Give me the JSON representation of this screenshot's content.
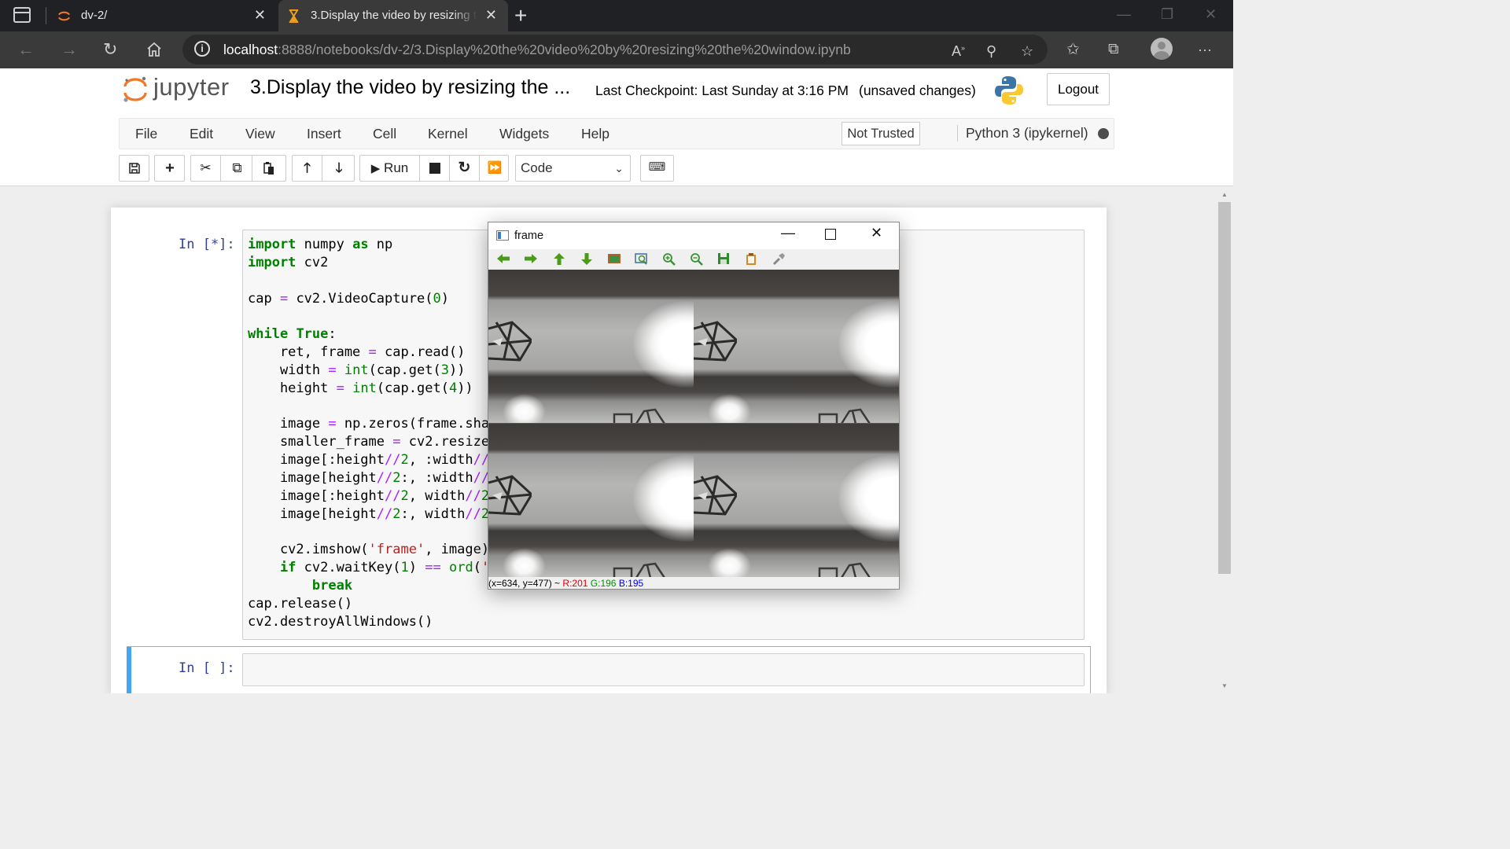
{
  "browser": {
    "tabs": [
      {
        "label": "dv-2/"
      },
      {
        "label": "3.Display the video by resizing th"
      }
    ],
    "url_host": "localhost",
    "url_rest": ":8888/notebooks/dv-2/3.Display%20the%20video%20by%20resizing%20the%20window.ipynb"
  },
  "jupyter": {
    "logo_text": "jupyter",
    "notebook_title": "3.Display the video by resizing the ...",
    "checkpoint": "Last Checkpoint: Last Sunday at 3:16 PM",
    "unsaved": "(unsaved changes)",
    "logout_label": "Logout"
  },
  "menu": {
    "items": [
      "File",
      "Edit",
      "View",
      "Insert",
      "Cell",
      "Kernel",
      "Widgets",
      "Help"
    ],
    "trust_label": "Not Trusted",
    "kernel_name": "Python 3 (ipykernel)"
  },
  "toolbar": {
    "run_label": "Run",
    "cell_type": "Code"
  },
  "cells": [
    {
      "prompt": "In [*]:"
    },
    {
      "prompt": "In [ ]:"
    }
  ],
  "code_lines": [
    "import numpy as np",
    "import cv2",
    "",
    "cap = cv2.VideoCapture(0)",
    "",
    "while True:",
    "    ret, frame = cap.read()",
    "    width = int(cap.get(3))",
    "    height = int(cap.get(4))",
    "",
    "    image = np.zeros(frame.sha",
    "    smaller_frame = cv2.resize",
    "    image[:height//2, :width//",
    "    image[height//2:, :width//",
    "    image[:height//2, width//2",
    "    image[height//2:, width//2",
    "",
    "    cv2.imshow('frame', image)",
    "    if cv2.waitKey(1) == ord('",
    "        break",
    "cap.release()",
    "cv2.destroyAllWindows()"
  ],
  "cv_window": {
    "title": "frame",
    "status_coords": "(x=634, y=477) ~",
    "status_r": "R:201",
    "status_g": "G:196",
    "status_b": "B:195"
  },
  "colors": {
    "keyword": "#008000",
    "operator": "#aa22ff",
    "string": "#ba2121",
    "prompt": "#303f9f",
    "selected_cell_bar": "#42a5f5",
    "tab_active_icon": "#f0a020"
  }
}
